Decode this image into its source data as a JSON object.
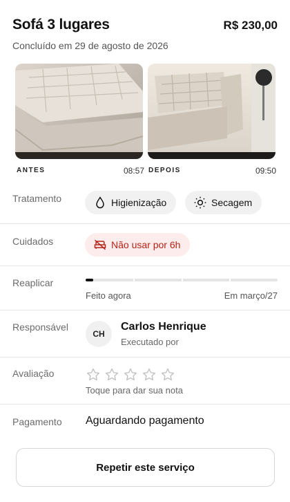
{
  "header": {
    "title": "Sofá 3 lugares",
    "price": "R$ 230,00",
    "subtitle": "Concluído em 29 de agosto de 2026"
  },
  "photos": {
    "before": {
      "tag": "ANTES",
      "time": "08:57"
    },
    "after": {
      "tag": "DEPOIS",
      "time": "09:50"
    }
  },
  "treatment": {
    "label": "Tratamento",
    "items": [
      {
        "label": "Higienização",
        "icon": "droplet-icon"
      },
      {
        "label": "Secagem",
        "icon": "sun-icon"
      }
    ]
  },
  "care": {
    "label": "Cuidados",
    "warning": "Não usar por 6h",
    "icon": "no-sofa-icon",
    "color": "#b42318"
  },
  "reapply": {
    "label": "Reaplicar",
    "progress": 0.04,
    "left_label": "Feito agora",
    "right_label": "Em março/27"
  },
  "responsible": {
    "label": "Responsável",
    "initials": "CH",
    "name": "Carlos Henrique",
    "note": "Executado por"
  },
  "rating": {
    "label": "Avaliação",
    "stars": 0,
    "max": 5,
    "hint": "Toque para dar sua nota"
  },
  "payment": {
    "label": "Pagamento",
    "status": "Aguardando pagamento"
  },
  "cta": {
    "label": "Repetir este serviço"
  }
}
